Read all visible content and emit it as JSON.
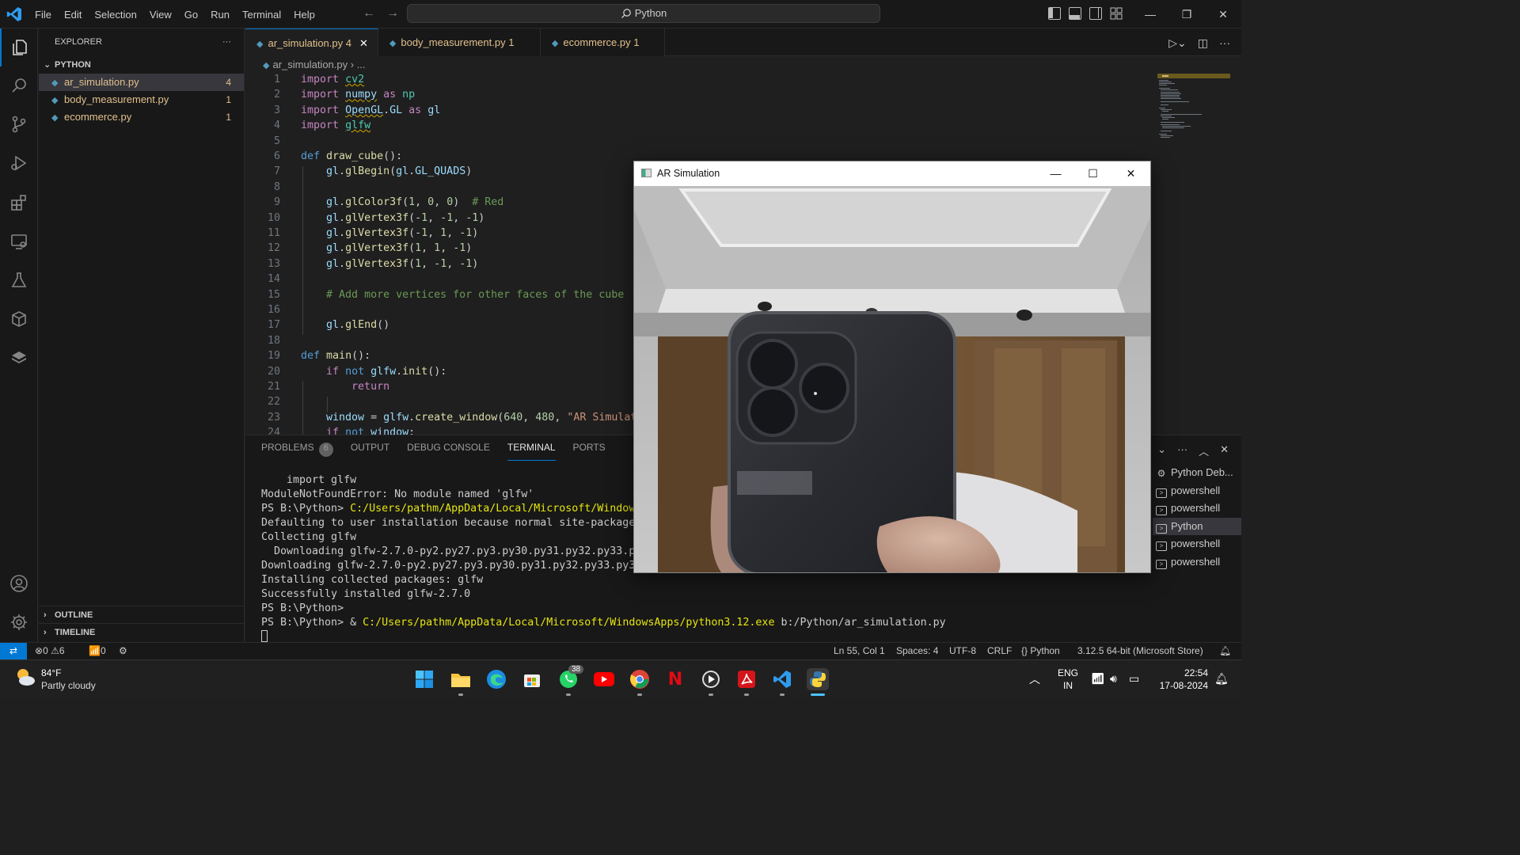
{
  "titlebar": {
    "menus": [
      "File",
      "Edit",
      "Selection",
      "View",
      "Go",
      "Run",
      "Terminal",
      "Help"
    ],
    "command_center": "Python"
  },
  "sidebar": {
    "header": "EXPLORER",
    "more": "···",
    "folder": "PYTHON",
    "files": [
      {
        "name": "ar_simulation.py",
        "count": "4"
      },
      {
        "name": "body_measurement.py",
        "count": "1"
      },
      {
        "name": "ecommerce.py",
        "count": "1"
      }
    ],
    "outline": "OUTLINE",
    "timeline": "TIMELINE"
  },
  "tabs": [
    {
      "label": "ar_simulation.py",
      "count": "4"
    },
    {
      "label": "body_measurement.py",
      "count": "1"
    },
    {
      "label": "ecommerce.py",
      "count": "1"
    }
  ],
  "breadcrumb": {
    "file": "ar_simulation.py",
    "rest": "..."
  },
  "code_line_numbers": [
    "1",
    "2",
    "3",
    "4",
    "5",
    "6",
    "7",
    "8",
    "9",
    "10",
    "11",
    "12",
    "13",
    "14",
    "15",
    "16",
    "17",
    "18",
    "19",
    "20",
    "21",
    "22",
    "23",
    "24"
  ],
  "panel": {
    "tabs": {
      "problems": "PROBLEMS",
      "problems_count": "6",
      "output": "OUTPUT",
      "debug": "DEBUG CONSOLE",
      "terminal": "TERMINAL",
      "ports": "PORTS"
    },
    "terminal_lines": [
      "    import glfw",
      "ModuleNotFoundError: No module named 'glfw'",
      "PS B:\\Python> ",
      "Defaulting to user installation because normal site-packages is",
      "Collecting glfw",
      "  Downloading glfw-2.7.0-py2.py27.py3.py30.py31.py32.py33.py34.p",
      "Downloading glfw-2.7.0-py2.py27.py3.py30.py31.py32.py33.py34.py3",
      "Installing collected packages: glfw",
      "Successfully installed glfw-2.7.0",
      "PS B:\\Python>",
      "PS B:\\Python> & "
    ],
    "terminal_path_partial": "C:/Users/pathm/AppData/Local/Microsoft/WindowsApps",
    "terminal_path_full": "C:/Users/pathm/AppData/Local/Microsoft/WindowsApps/python3.12.exe",
    "terminal_arg": " b:/Python/ar_simulation.py",
    "terminals": [
      "Python Deb...",
      "powershell",
      "powershell",
      "Python",
      "powershell",
      "powershell"
    ]
  },
  "statusbar": {
    "errors": "0",
    "warnings": "6",
    "ports": "0",
    "position": "Ln 55, Col 1",
    "spaces": "Spaces: 4",
    "encoding": "UTF-8",
    "eol": "CRLF",
    "language": "Python",
    "interpreter": "3.12.5 64-bit (Microsoft Store)"
  },
  "ar_window": {
    "title": "AR Simulation"
  },
  "taskbar": {
    "temp": "84°F",
    "weather": "Partly cloudy",
    "whatsapp_badge": "38",
    "lang1": "ENG",
    "lang2": "IN",
    "time": "22:54",
    "date": "17-08-2024"
  },
  "colors": {
    "accent": "#0078d4",
    "modified": "#e2c08d",
    "editor_bg": "#1f1f1f",
    "chrome_bg": "#181818"
  }
}
